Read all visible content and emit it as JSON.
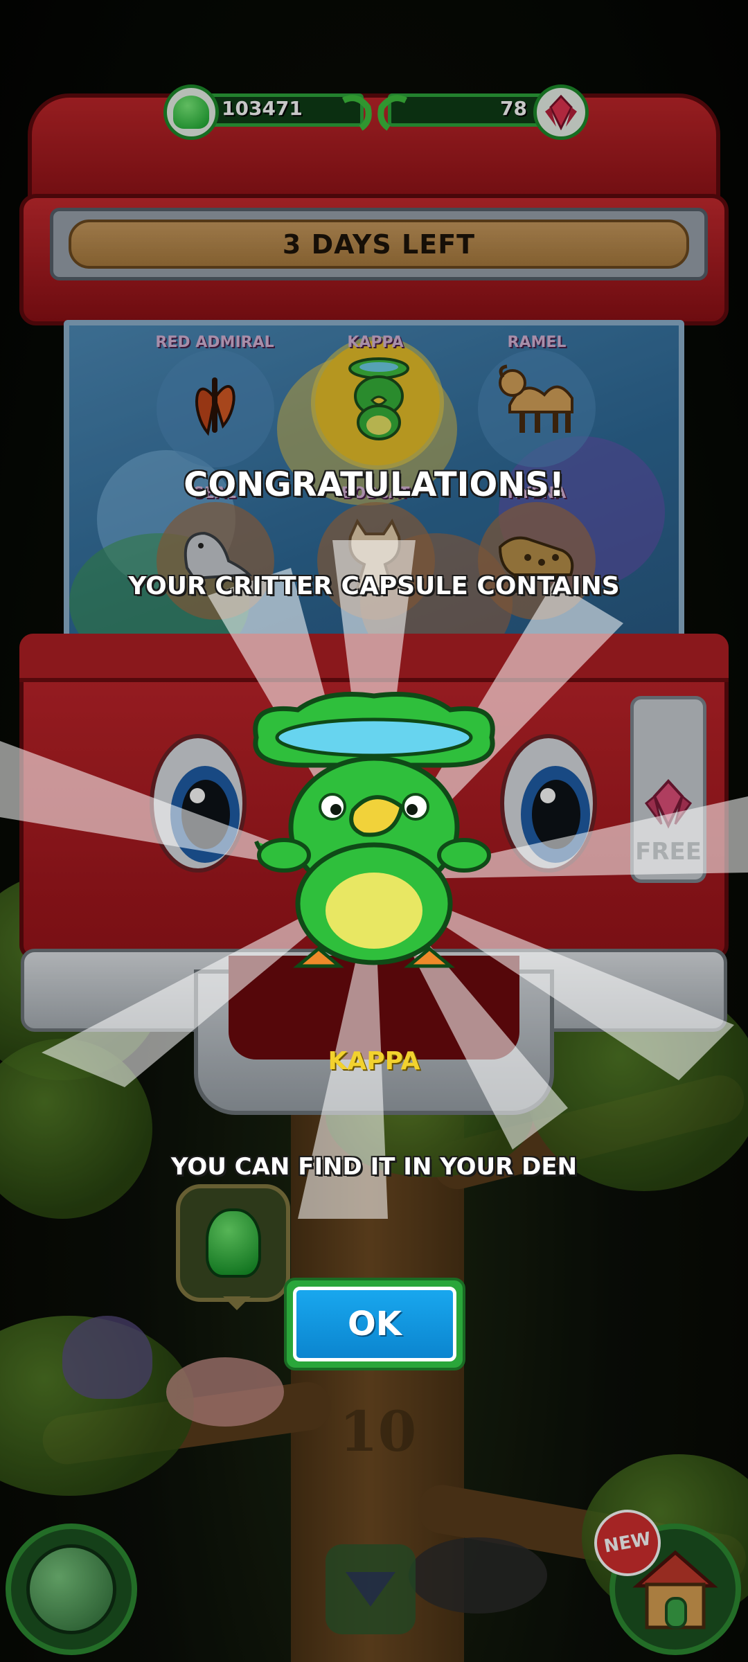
{
  "hud": {
    "coins": "103471",
    "gems": "78",
    "coin_icon": "green-gumdrop-icon",
    "gem_icon": "red-gem-icon"
  },
  "machine": {
    "banner": "3 DAYS LEFT",
    "free_label": "FREE",
    "prizes": [
      {
        "label": "RED ADMIRAL",
        "icon": "butterfly"
      },
      {
        "label": "KAPPA",
        "icon": "kappa",
        "highlighted": true
      },
      {
        "label": "RAMEL",
        "icon": "camel"
      },
      {
        "label": "SEAL",
        "icon": "seal"
      },
      {
        "label": "BOBCAT",
        "icon": "bobcat"
      },
      {
        "label": "HYENA",
        "icon": "hyena"
      }
    ]
  },
  "reward": {
    "heading": "CONGRATULATIONS!",
    "subheading": "YOUR CRITTER CAPSULE CONTAINS",
    "critter_name": "KAPPA",
    "note": "YOU CAN FIND IT IN YOUR DEN",
    "ok_label": "OK"
  },
  "tree": {
    "level": "10"
  },
  "bottom_nav": {
    "new_badge": "NEW"
  },
  "colors": {
    "machine_red": "#b11f25",
    "ok_blue": "#0f95df",
    "highlight_yellow": "#f2d22e",
    "hud_green": "#2ea63b"
  }
}
